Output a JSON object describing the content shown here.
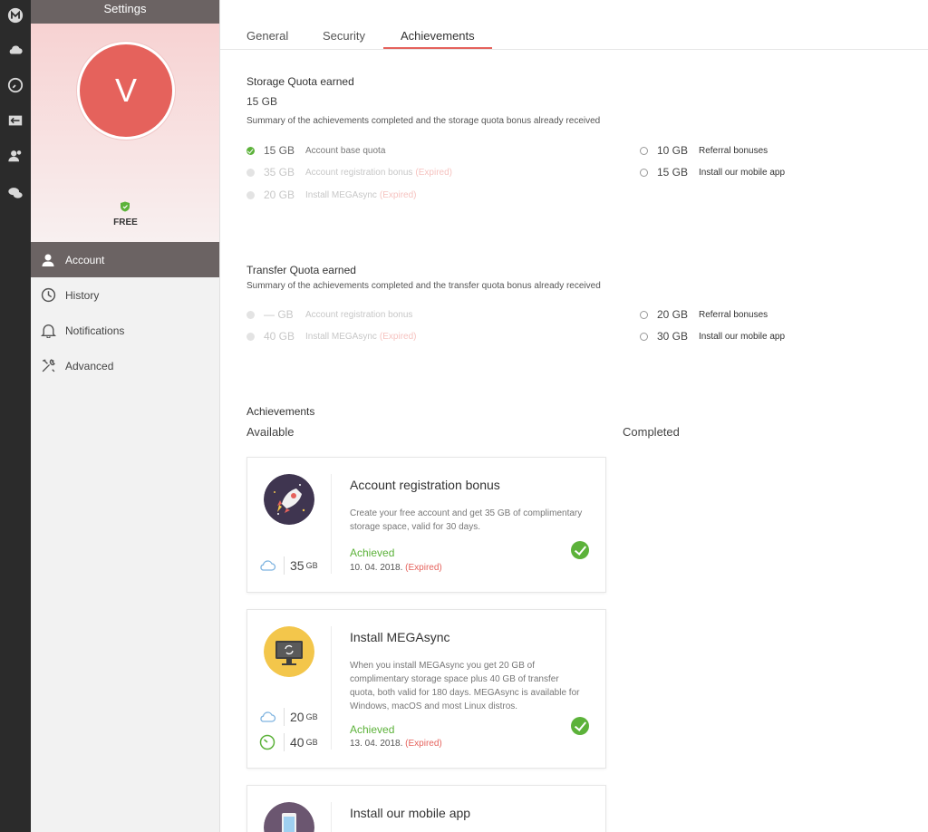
{
  "rail": {
    "icons": [
      "mega-logo-icon",
      "cloud-icon",
      "clock-icon",
      "transfers-icon",
      "contacts-icon",
      "chat-icon"
    ]
  },
  "sidebar": {
    "title": "Settings",
    "avatar_initial": "V",
    "plan": "FREE",
    "items": [
      {
        "label": "Account",
        "icon": "user-icon",
        "active": true
      },
      {
        "label": "History",
        "icon": "history-icon",
        "active": false
      },
      {
        "label": "Notifications",
        "icon": "bell-icon",
        "active": false
      },
      {
        "label": "Advanced",
        "icon": "tools-icon",
        "active": false
      }
    ]
  },
  "tabs": [
    {
      "label": "General"
    },
    {
      "label": "Security"
    },
    {
      "label": "Achievements",
      "active": true
    }
  ],
  "storage": {
    "title": "Storage Quota earned",
    "total": "15 GB",
    "summary": "Summary of the achievements completed and the storage quota bonus already received",
    "left": [
      {
        "amount": "15 GB",
        "label": "Account base quota",
        "expired": "",
        "state": "done"
      },
      {
        "amount": "35 GB",
        "label": "Account registration bonus",
        "expired": "(Expired)",
        "state": "dim"
      },
      {
        "amount": "20 GB",
        "label": "Install MEGAsync",
        "expired": "(Expired)",
        "state": "dim"
      }
    ],
    "right": [
      {
        "amount": "10 GB",
        "label": "Referral bonuses"
      },
      {
        "amount": "15 GB",
        "label": "Install our mobile app"
      }
    ]
  },
  "transfer": {
    "title": "Transfer Quota earned",
    "summary": "Summary of the achievements completed and the transfer quota bonus already received",
    "left": [
      {
        "amount": "— GB",
        "label": "Account registration bonus",
        "expired": "",
        "state": "dim"
      },
      {
        "amount": "40 GB",
        "label": "Install MEGAsync",
        "expired": "(Expired)",
        "state": "dim"
      }
    ],
    "right": [
      {
        "amount": "20 GB",
        "label": "Referral bonuses"
      },
      {
        "amount": "30 GB",
        "label": "Install our mobile app"
      }
    ]
  },
  "achievements": {
    "title": "Achievements",
    "available_label": "Available",
    "completed_label": "Completed",
    "cards": [
      {
        "title": "Account registration bonus",
        "description": "Create your free account and get 35 GB of complimentary storage space, valid for 30 days.",
        "status": "Achieved",
        "date": "10. 04. 2018.",
        "expired": "(Expired)",
        "storage_amount": "35",
        "storage_unit": "GB"
      },
      {
        "title": "Install MEGAsync",
        "description": "When you install MEGAsync you get 20 GB of complimentary storage space plus 40 GB of transfer quota, both valid for 180 days. MEGAsync is available for Windows, macOS and most Linux distros.",
        "status": "Achieved",
        "date": "13. 04. 2018.",
        "expired": "(Expired)",
        "storage_amount": "20",
        "storage_unit": "GB",
        "transfer_amount": "40",
        "transfer_unit": "GB"
      },
      {
        "title": "Install our mobile app"
      }
    ]
  },
  "colors": {
    "accent": "#e5625c",
    "success": "#5cb23a",
    "rail": "#2b2b2b",
    "sidebar_header": "#6b6363"
  }
}
